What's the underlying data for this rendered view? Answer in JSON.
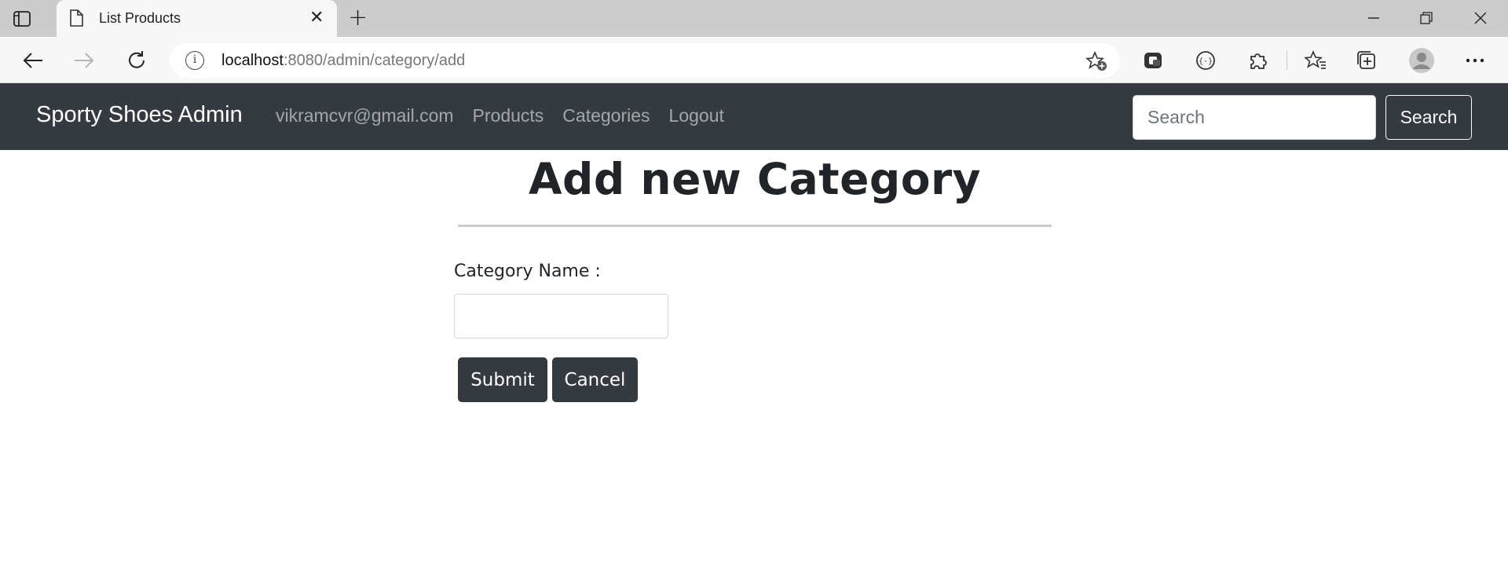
{
  "browser": {
    "tab_title": "List Products",
    "tab_close": "✕",
    "new_tab": "+",
    "url_host": "localhost",
    "url_path": ":8080/admin/category/add"
  },
  "navbar": {
    "brand": "Sporty Shoes Admin",
    "links": [
      "vikramcvr@gmail.com",
      "Products",
      "Categories",
      "Logout"
    ],
    "search_placeholder": "Search",
    "search_button": "Search"
  },
  "form": {
    "title": "Add new Category",
    "category_label": "Category Name :",
    "category_value": "",
    "submit_label": "Submit",
    "cancel_label": "Cancel"
  },
  "colors": {
    "navbar_bg": "#343a40",
    "button_bg": "#343a40",
    "chrome_tabstrip": "#cccccc"
  }
}
